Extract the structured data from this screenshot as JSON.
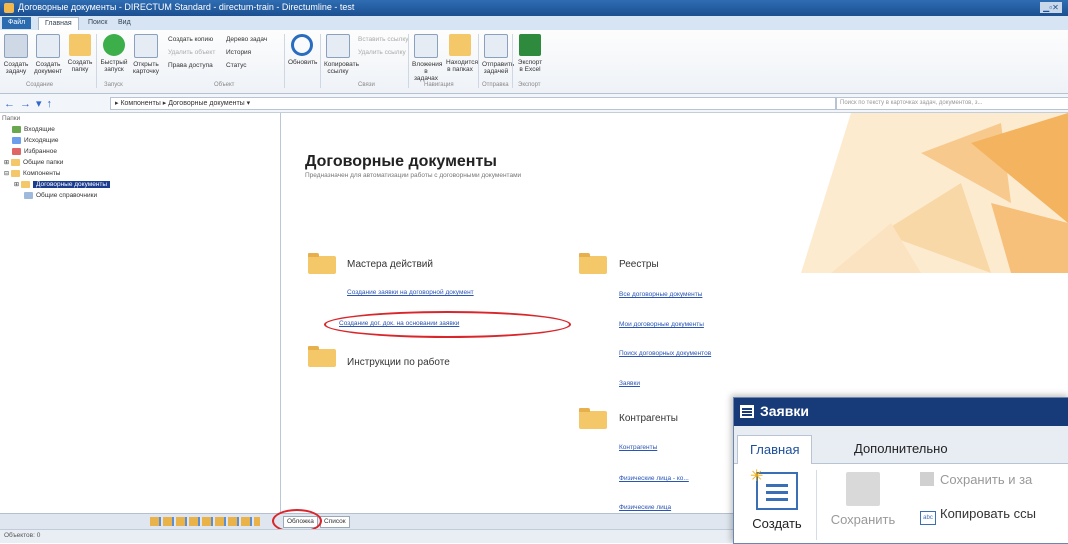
{
  "window": {
    "title": "Договорные документы - DIRECTUM Standard - directum-train - Directumline - test"
  },
  "ribbon_tabs": [
    {
      "label": "Файл"
    },
    {
      "label": "Главная"
    },
    {
      "label": "Поиск"
    },
    {
      "label": "Вид"
    }
  ],
  "ribbon": {
    "buttons": [
      {
        "label": "Создать задачу"
      },
      {
        "label": "Создать документ"
      },
      {
        "label": "Создать папку"
      },
      {
        "label": "Быстрый запуск"
      },
      {
        "label": "Открыть карточку"
      },
      {
        "label": "Обновить"
      },
      {
        "label": "Копировать ссылку"
      },
      {
        "label": "Вложения в задачах"
      },
      {
        "label": "Находится в папках"
      },
      {
        "label": "Отправить задачей"
      },
      {
        "label": "Экспорт в Excel"
      }
    ],
    "small_items": [
      {
        "label": "Создать копию"
      },
      {
        "label": "Удалить объект"
      },
      {
        "label": "Права доступа"
      },
      {
        "label": "Дерево задач"
      },
      {
        "label": "История"
      },
      {
        "label": "Статус"
      },
      {
        "label": "Вставить ссылку"
      },
      {
        "label": "Удалить ссылку"
      }
    ],
    "groups": [
      {
        "label": "Создание"
      },
      {
        "label": "Запуск"
      },
      {
        "label": "Объект"
      },
      {
        "label": "Связи"
      },
      {
        "label": "Навигация"
      },
      {
        "label": "Отправка"
      },
      {
        "label": "Экспорт"
      }
    ]
  },
  "addressbar": {
    "path": "▸ Компоненты ▸ Договорные документы ▾",
    "search_placeholder": "Поиск по тексту в карточках задач, документов, з..."
  },
  "tree": {
    "header": "Папки",
    "items": [
      {
        "label": "Входящие"
      },
      {
        "label": "Исходящие"
      },
      {
        "label": "Избранное"
      },
      {
        "label": "Общие папки"
      },
      {
        "label": "Компоненты"
      },
      {
        "label": "Договорные документы"
      },
      {
        "label": "Общие справочники"
      }
    ]
  },
  "main": {
    "title": "Договорные документы",
    "subtitle": "Предназначен для автоматизации работы с договорными документами",
    "sections": [
      {
        "title": "Мастера действий",
        "links": [
          {
            "label": "Создание заявки на договорной документ"
          },
          {
            "label": "Создание дог. док. на основании заявки"
          }
        ]
      },
      {
        "title": "Инструкции по работе",
        "links": []
      },
      {
        "title": "Реестры",
        "links": [
          {
            "label": "Все договорные документы"
          },
          {
            "label": "Мои договорные документы"
          },
          {
            "label": "Поиск договорных документов"
          },
          {
            "label": "Заявки"
          }
        ]
      },
      {
        "title": "Контрагенты",
        "links": [
          {
            "label": "Контрагенты"
          },
          {
            "label": "Физические лица - ко..."
          },
          {
            "label": "Физические лица"
          }
        ]
      }
    ]
  },
  "bottom": {
    "tabs": [
      {
        "label": "Обложка"
      },
      {
        "label": "Список"
      }
    ],
    "status": "Объектов: 0"
  },
  "popup": {
    "title": "Заявки",
    "tabs": [
      {
        "label": "Главная"
      },
      {
        "label": "Дополнительно"
      }
    ],
    "create_label": "Создать",
    "save_label": "Сохранить",
    "save_and_label": "Сохранить и за",
    "copy_link_label": "Копировать ссы"
  }
}
